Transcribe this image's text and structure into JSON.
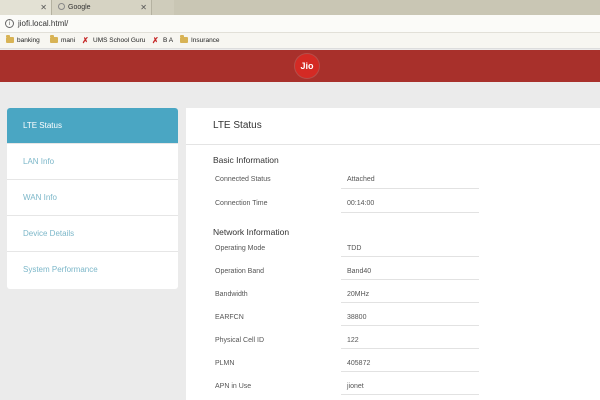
{
  "browser": {
    "tabs": [
      {
        "label": ""
      },
      {
        "label": "Google"
      },
      {
        "label": ""
      }
    ],
    "url": "jiofi.local.html/",
    "bookmarks": [
      {
        "label": "banking",
        "icon": "folder-icon"
      },
      {
        "label": "mani",
        "icon": "folder-icon"
      },
      {
        "label": "UMS School Guru",
        "icon": "ums-icon"
      },
      {
        "label": "B A",
        "icon": "ums-icon"
      },
      {
        "label": "Insurance",
        "icon": "folder-icon"
      }
    ]
  },
  "header": {
    "logo_text": "Jio",
    "color": "#a8302b"
  },
  "sidebar": {
    "items": [
      {
        "label": "LTE Status"
      },
      {
        "label": "LAN Info"
      },
      {
        "label": "WAN Info"
      },
      {
        "label": "Device Details"
      },
      {
        "label": "System Performance"
      }
    ],
    "active_color": "#4aa6c3"
  },
  "main": {
    "title": "LTE Status",
    "basic": {
      "title": "Basic Information",
      "rows": [
        {
          "label": "Connected Status",
          "value": "Attached"
        },
        {
          "label": "Connection Time",
          "value": "00:14:00"
        }
      ]
    },
    "network": {
      "title": "Network Information",
      "rows": [
        {
          "label": "Operating Mode",
          "value": "TDD"
        },
        {
          "label": "Operation Band",
          "value": "Band40"
        },
        {
          "label": "Bandwidth",
          "value": "20MHz"
        },
        {
          "label": "EARFCN",
          "value": "38800"
        },
        {
          "label": "Physical Cell ID",
          "value": "122"
        },
        {
          "label": "PLMN",
          "value": "405872"
        },
        {
          "label": "APN in Use",
          "value": "jionet"
        }
      ]
    }
  }
}
